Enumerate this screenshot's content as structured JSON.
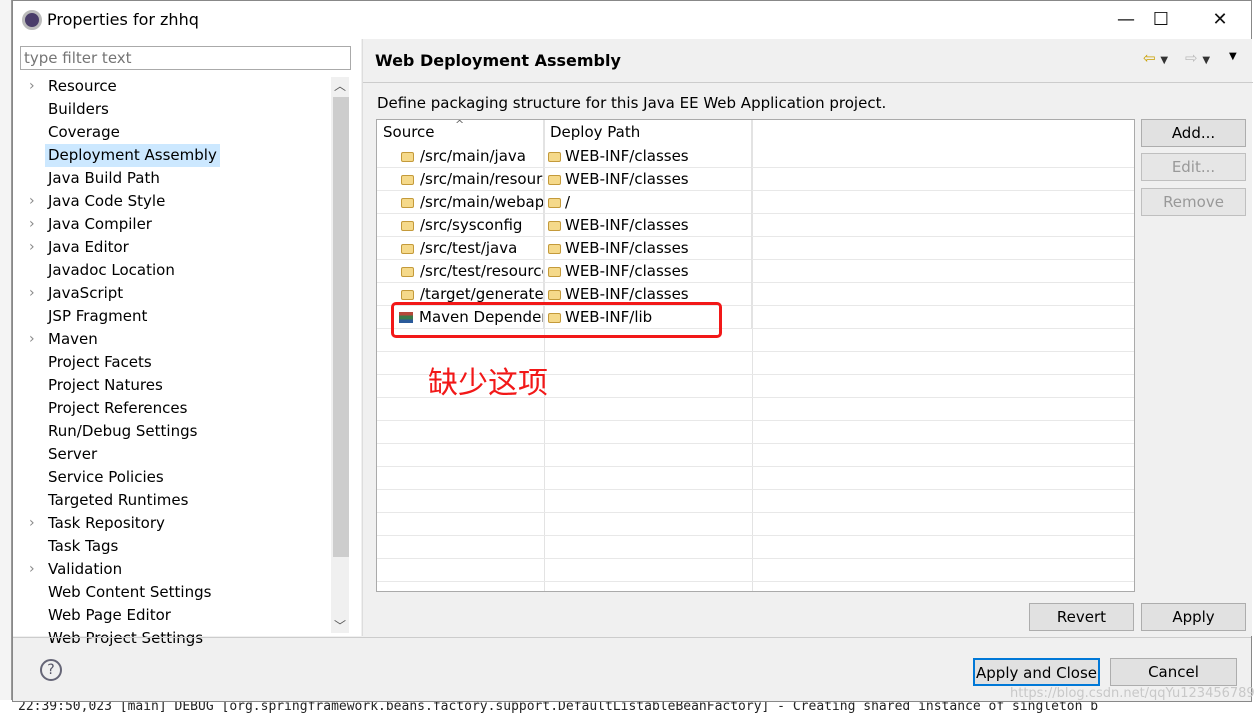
{
  "window": {
    "title": "Properties for zhhq",
    "minimize": "—",
    "maximize": "☐",
    "close": "✕"
  },
  "filter": {
    "placeholder": "type filter text"
  },
  "tree": [
    {
      "label": "Resource",
      "expandable": true
    },
    {
      "label": "Builders",
      "expandable": false
    },
    {
      "label": "Coverage",
      "expandable": false
    },
    {
      "label": "Deployment Assembly",
      "expandable": false,
      "selected": true
    },
    {
      "label": "Java Build Path",
      "expandable": false
    },
    {
      "label": "Java Code Style",
      "expandable": true
    },
    {
      "label": "Java Compiler",
      "expandable": true
    },
    {
      "label": "Java Editor",
      "expandable": true
    },
    {
      "label": "Javadoc Location",
      "expandable": false
    },
    {
      "label": "JavaScript",
      "expandable": true
    },
    {
      "label": "JSP Fragment",
      "expandable": false
    },
    {
      "label": "Maven",
      "expandable": true
    },
    {
      "label": "Project Facets",
      "expandable": false
    },
    {
      "label": "Project Natures",
      "expandable": false
    },
    {
      "label": "Project References",
      "expandable": false
    },
    {
      "label": "Run/Debug Settings",
      "expandable": false
    },
    {
      "label": "Server",
      "expandable": false
    },
    {
      "label": "Service Policies",
      "expandable": false
    },
    {
      "label": "Targeted Runtimes",
      "expandable": false
    },
    {
      "label": "Task Repository",
      "expandable": true
    },
    {
      "label": "Task Tags",
      "expandable": false
    },
    {
      "label": "Validation",
      "expandable": true
    },
    {
      "label": "Web Content Settings",
      "expandable": false
    },
    {
      "label": "Web Page Editor",
      "expandable": false
    },
    {
      "label": "Web Project Settings",
      "expandable": false
    }
  ],
  "page": {
    "title": "Web Deployment Assembly",
    "description": "Define packaging structure for this Java EE Web Application project."
  },
  "table": {
    "headers": [
      "Source",
      "Deploy Path"
    ],
    "rows": [
      {
        "source": "/src/main/java",
        "deploy": "WEB-INF/classes",
        "icon": "folder"
      },
      {
        "source": "/src/main/resources",
        "deploy": "WEB-INF/classes",
        "icon": "folder"
      },
      {
        "source": "/src/main/webapp",
        "deploy": "/",
        "icon": "folder"
      },
      {
        "source": "/src/sysconfig",
        "deploy": "WEB-INF/classes",
        "icon": "folder"
      },
      {
        "source": "/src/test/java",
        "deploy": "WEB-INF/classes",
        "icon": "folder"
      },
      {
        "source": "/src/test/resources",
        "deploy": "WEB-INF/classes",
        "icon": "folder"
      },
      {
        "source": "/target/generated",
        "deploy": "WEB-INF/classes",
        "icon": "folder"
      },
      {
        "source": "Maven Dependencies",
        "deploy": "WEB-INF/lib",
        "icon": "library"
      }
    ]
  },
  "buttons": {
    "add": "Add...",
    "edit": "Edit...",
    "remove": "Remove",
    "revert": "Revert",
    "apply": "Apply",
    "apply_close": "Apply and Close",
    "cancel": "Cancel"
  },
  "annotation": {
    "text": "缺少这项",
    "color": "#f21818"
  },
  "watermark": "https://blog.csdn.net/qqYu123456789",
  "console": "22:39:50,023 [main] DEBUG [org.springframework.beans.factory.support.DefaultListableBeanFactory] - Creating shared instance of singleton b"
}
